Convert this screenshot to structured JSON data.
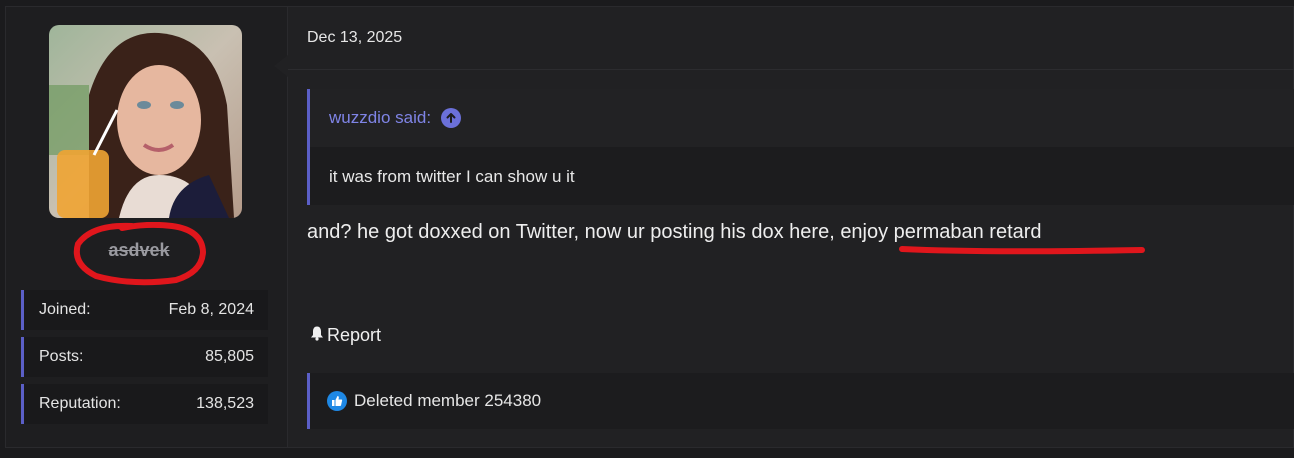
{
  "user": {
    "username": "asdvek",
    "stats": [
      {
        "label": "Joined:",
        "value": "Feb 8, 2024"
      },
      {
        "label": "Posts:",
        "value": "85,805"
      },
      {
        "label": "Reputation:",
        "value": "138,523"
      }
    ]
  },
  "post": {
    "date": "Dec 13, 2025",
    "quote": {
      "author_label": "wuzzdio said:",
      "text": "it was from twitter I can show u it"
    },
    "message_part1": "and? he got doxxed on Twitter, now ur posting his dox here, ",
    "message_part2": "enjoy permaban retard",
    "report_label": "Report",
    "reaction_member": "Deleted member 254380"
  },
  "colors": {
    "accent": "#5b5fc7",
    "quote_link": "#7f84e6",
    "annotation_red": "#e0161c",
    "like_blue": "#1e88e5"
  },
  "icons": {
    "jump": "arrow-up-circle-icon",
    "report": "bell-icon",
    "reaction": "thumbs-up-icon"
  }
}
